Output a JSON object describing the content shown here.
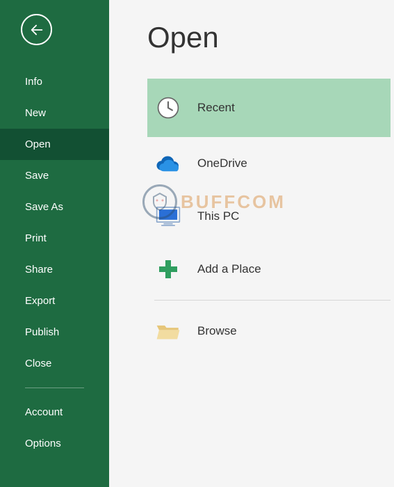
{
  "sidebar": {
    "items": [
      {
        "label": "Info"
      },
      {
        "label": "New"
      },
      {
        "label": "Open"
      },
      {
        "label": "Save"
      },
      {
        "label": "Save As"
      },
      {
        "label": "Print"
      },
      {
        "label": "Share"
      },
      {
        "label": "Export"
      },
      {
        "label": "Publish"
      },
      {
        "label": "Close"
      }
    ],
    "secondary": [
      {
        "label": "Account"
      },
      {
        "label": "Options"
      }
    ]
  },
  "main": {
    "title": "Open",
    "sources": [
      {
        "label": "Recent"
      },
      {
        "label": "OneDrive"
      },
      {
        "label": "This PC"
      },
      {
        "label": "Add a Place"
      },
      {
        "label": "Browse"
      }
    ]
  },
  "watermark": {
    "text": "BUFFCOM"
  }
}
